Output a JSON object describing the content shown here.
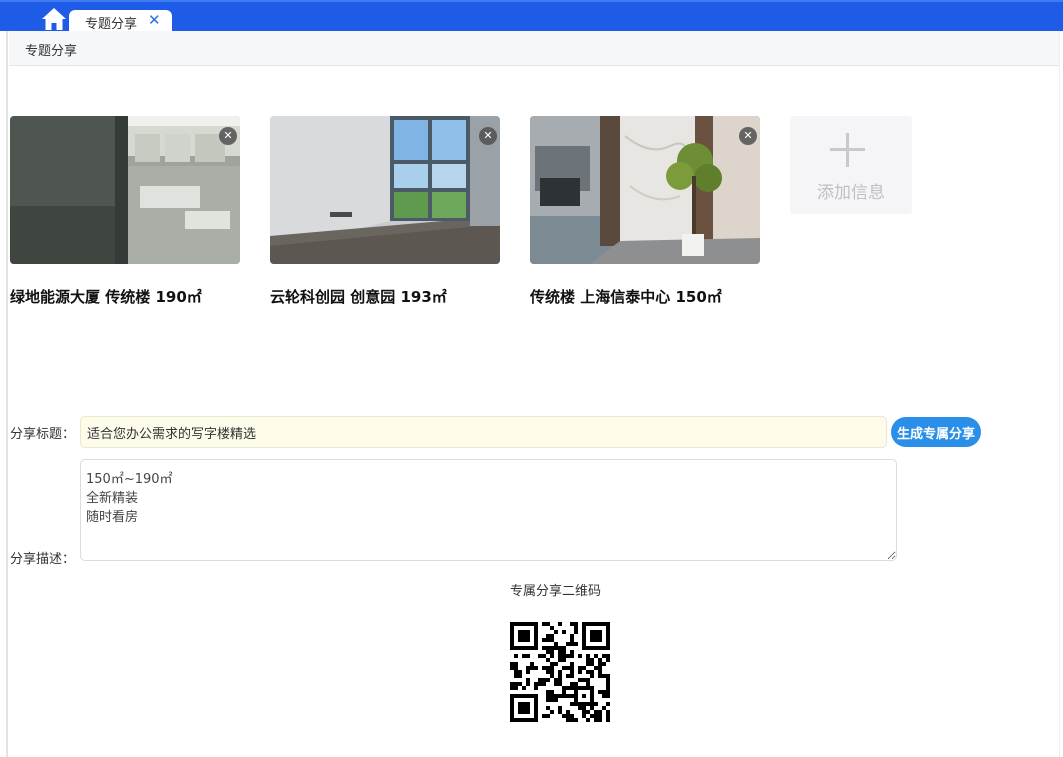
{
  "header": {
    "tab_label": "专题分享",
    "tab_close": "✕",
    "brand_color": "#1e5be6"
  },
  "breadcrumb": "专题分享",
  "cards": [
    {
      "title": "绿地能源大厦 传统楼 190㎡",
      "delete_icon": "✕"
    },
    {
      "title": "云轮科创园 创意园 193㎡",
      "delete_icon": "✕"
    },
    {
      "title": "传统楼 上海信泰中心 150㎡",
      "delete_icon": "✕"
    }
  ],
  "add_card": {
    "label": "添加信息",
    "icon": "plus-icon"
  },
  "form": {
    "title_label": "分享标题：",
    "title_value": "适合您办公需求的写字楼精选",
    "generate_button": "生成专属分享",
    "desc_label": "分享描述：",
    "desc_value": "150㎡~190㎡\n全新精装\n随时看房"
  },
  "qr": {
    "label": "专属分享二维码"
  }
}
